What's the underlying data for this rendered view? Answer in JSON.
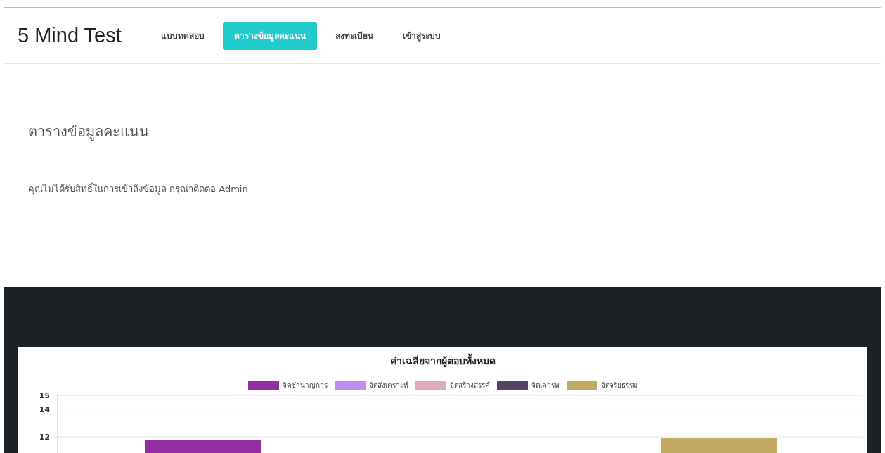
{
  "navbar": {
    "brand": "5 Mind Test",
    "items": [
      {
        "label": "แบบทดสอบ",
        "selected": false
      },
      {
        "label": "ตารางข้อมูลคะแนน",
        "selected": true
      },
      {
        "label": "ลงทะเบียน",
        "selected": false
      },
      {
        "label": "เข้าสู่ระบบ",
        "selected": false
      }
    ]
  },
  "page": {
    "heading": "ตารางข้อมูลคะแนน",
    "message": "คุณไม่ได้รับสิทธิ์ในการเข้าถึงข้อมูล กรุณาติดต่อ Admin"
  },
  "chart_data": {
    "type": "bar",
    "title": "ค่าเฉลี่ยจากผู้ตอบทั้งหมด",
    "legend": "top",
    "categories": [
      null
    ],
    "ylim": [
      0,
      15
    ],
    "yticks": [
      12,
      14,
      15
    ],
    "series": [
      {
        "name": "จิตชำนาญการ",
        "color": "#932da2",
        "values": [
          11.8
        ]
      },
      {
        "name": "จิตสังเคราะห์",
        "color": "#bd8ef0",
        "values": [
          null
        ]
      },
      {
        "name": "จิตสร้างสรรค์",
        "color": "#dfaabd",
        "values": [
          null
        ]
      },
      {
        "name": "จิตเคารพ",
        "color": "#514561",
        "values": [
          null
        ]
      },
      {
        "name": "จิตจริยธรรม",
        "color": "#c1a962",
        "values": [
          11.9
        ]
      }
    ]
  }
}
